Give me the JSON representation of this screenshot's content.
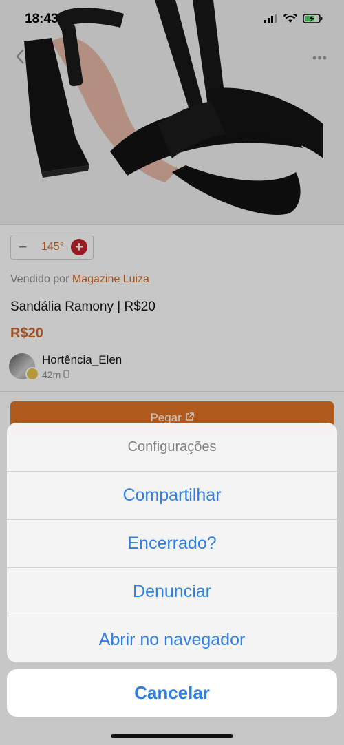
{
  "status": {
    "time": "18:43"
  },
  "product": {
    "vote_temp": "145°",
    "seller_prefix": "Vendido por",
    "seller_name": "Magazine Luiza",
    "title": "Sandália Ramony | R$20",
    "price": "R$20"
  },
  "author": {
    "username": "Hortência_Elen",
    "time": "42m"
  },
  "cta": {
    "label": "Pegar"
  },
  "action_sheet": {
    "title": "Configurações",
    "items": [
      "Compartilhar",
      "Encerrado?",
      "Denunciar",
      "Abrir no navegador"
    ],
    "cancel": "Cancelar"
  },
  "colors": {
    "accent": "#d06a2b",
    "ios_blue": "#2f7fe6",
    "hot": "#c0232c"
  }
}
